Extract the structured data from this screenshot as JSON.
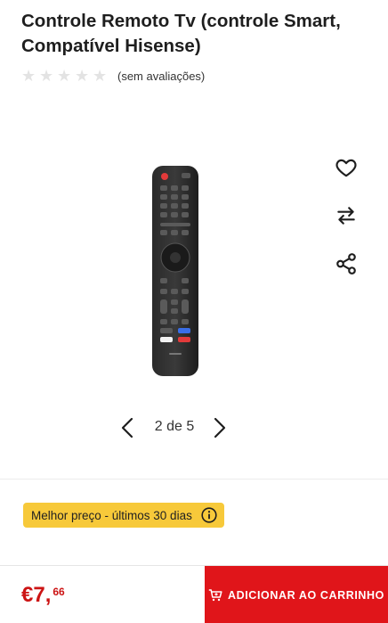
{
  "product": {
    "title": "Controle Remoto Tv (controle Smart, Compatível Hisense)"
  },
  "rating": {
    "stars": 0,
    "max_stars": 5,
    "text": "(sem avaliações)"
  },
  "actions": {
    "wishlist_icon": "heart-icon",
    "compare_icon": "compare-arrows-icon",
    "share_icon": "share-icon"
  },
  "gallery": {
    "pager_label": "2 de 5",
    "current": 2,
    "total": 5
  },
  "badge": {
    "text": "Melhor preço - últimos 30 dias"
  },
  "footer": {
    "price_main": "€7,",
    "price_cents": "66",
    "cart_label": "ADICIONAR AO CARRINHO"
  },
  "colors": {
    "accent_red": "#e0151a",
    "price_red": "#cc1414",
    "badge_yellow": "#f7c93a",
    "star_empty": "#e3e3e3"
  }
}
